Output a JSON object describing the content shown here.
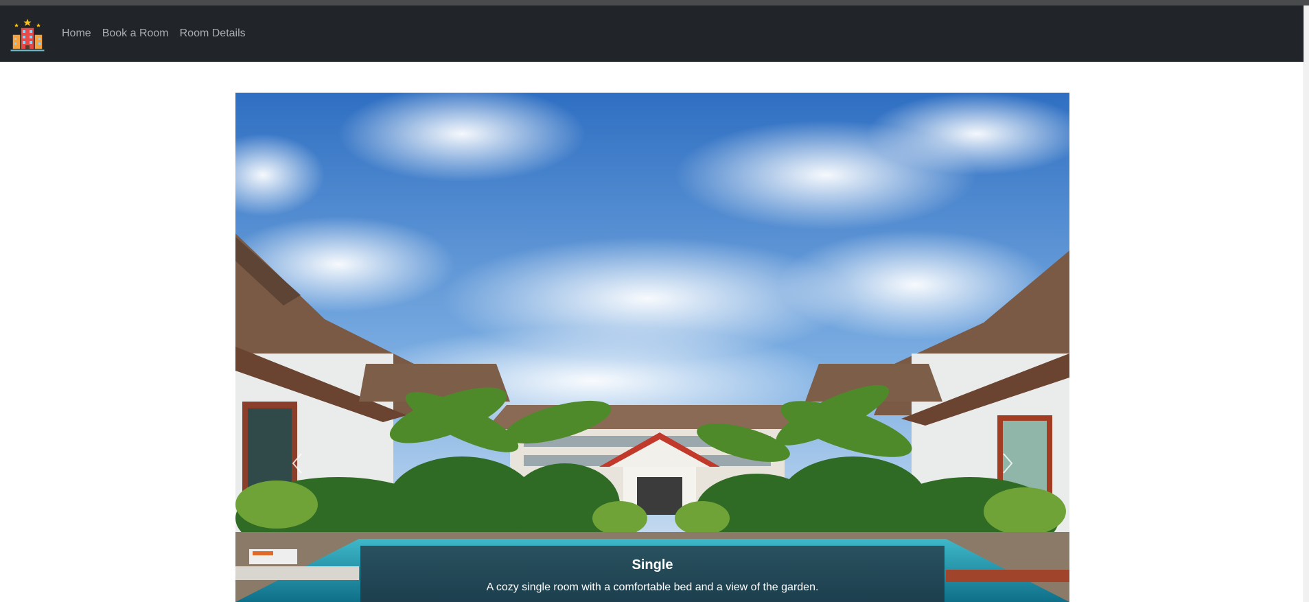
{
  "nav": {
    "logo_icon": "hotel-building-icon",
    "links": [
      "Home",
      "Book a Room",
      "Room Details"
    ]
  },
  "carousel": {
    "prev_icon": "chevron-left-icon",
    "next_icon": "chevron-right-icon",
    "slide": {
      "title": "Single",
      "description": "A cozy single room with a comfortable bed and a view of the garden."
    }
  },
  "colors": {
    "navbar": "#212529",
    "nav_link": "#a8adb3",
    "caption_bg": "#232d37",
    "button": "#0d6efd"
  }
}
